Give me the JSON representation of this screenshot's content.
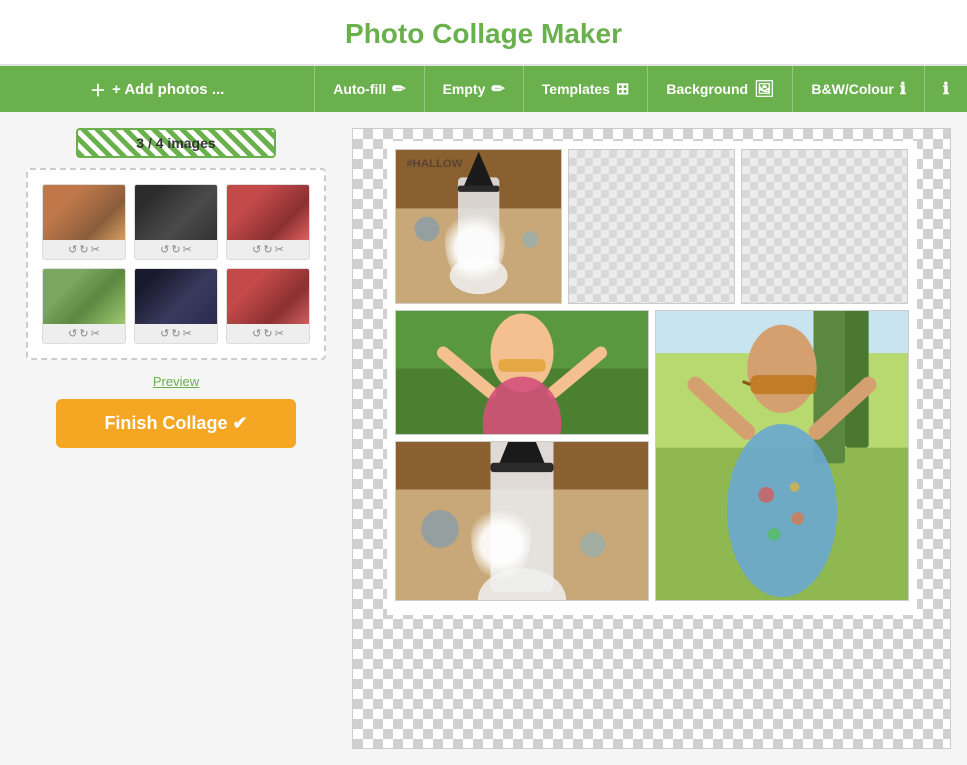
{
  "header": {
    "title": "Photo Collage Maker"
  },
  "toolbar": {
    "add_photos": "+ Add photos ...",
    "autofill": "Auto-fill",
    "empty": "Empty",
    "templates": "Templates",
    "background": "Background",
    "bw_colour": "B&W/Colour",
    "info": "ℹ"
  },
  "left_panel": {
    "image_count": "3 / 4 images",
    "preview_link": "Preview",
    "finish_button": "Finish Collage ✔"
  },
  "collage": {
    "top_row": [
      "halloween",
      "empty",
      "empty"
    ],
    "middle_left": "dancing",
    "bottom_left": "halloween2",
    "right_tall": "sunglasses"
  }
}
